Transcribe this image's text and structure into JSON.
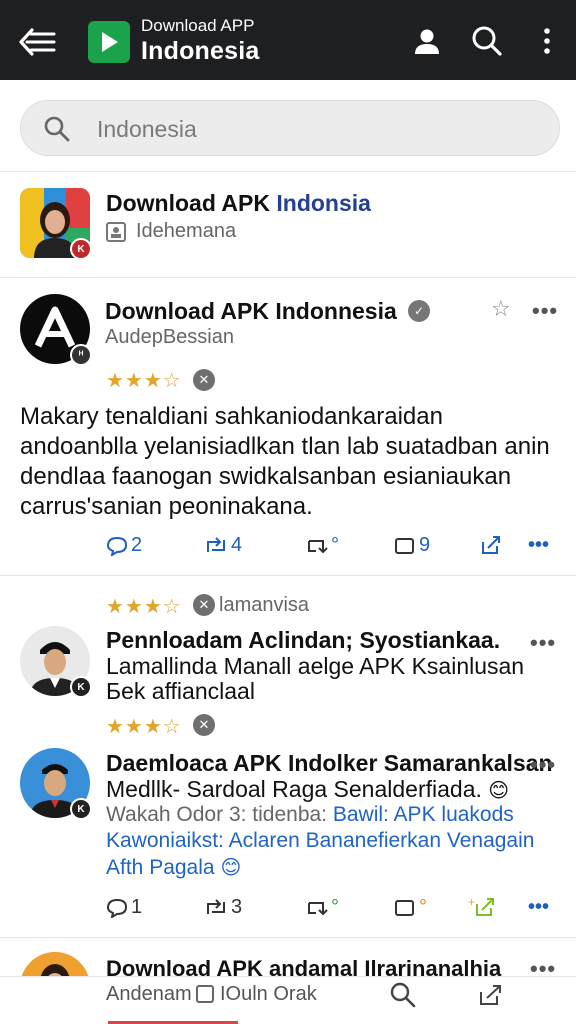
{
  "header": {
    "small_title": "Download APP",
    "big_title": "Indonesia",
    "back_icon": "back-arrow-icon",
    "logo_icon": "play-store-icon",
    "profile_icon": "profile-icon",
    "search_icon": "search-icon",
    "more_icon": "more-vertical-icon"
  },
  "search": {
    "value": "Indonesia"
  },
  "first_card": {
    "name_black": "Download APK ",
    "name_blue": "Indonsia",
    "sub": "Idehemana"
  },
  "post1": {
    "name": "Download APK Indonnesia",
    "handle": "AudepBessian",
    "stars": "★★★☆",
    "body": "Makary tenaldiani sahkaniodankaraidan andoanblla yelanisiadlkan tlan lab suatadban anin dendlaa faanogan swidkalsanban esianiaukan carrus'sanian peoninakana.",
    "actions": {
      "reply": "2",
      "repost": "4",
      "retweet": "°",
      "bookmark": "9",
      "share": "",
      "more": "•••"
    }
  },
  "post2": {
    "stars_top": "★★★☆",
    "top_label": "lamanvisa",
    "line1": "Pennloadam Aclindan; Syostiankaa.",
    "line2": "Lamallinda Manall aelge APK Ksainlusan",
    "line3": "Бek affianclaal",
    "stars_bottom": "★★★☆"
  },
  "post3": {
    "line1": "Daemloaca APK Indolker Samarankalsan",
    "line2": "Medllk- Sardoal Raga Senalderfiada.",
    "line3_gray": "Wakah Odor ",
    "line3_gray2": "3: tidenba: ",
    "line3_blue": "Bawil: APK luakods",
    "line4": "Kawoniaikst: Aclaren Bananefierkan Venagain",
    "line5": "Afth Pagala",
    "actions": {
      "reply": "1",
      "repost": "3",
      "retweet": "°",
      "bookmark": "°",
      "more": "•••"
    }
  },
  "bottom": {
    "name": "Download APK andamal Ilrarinanalhia",
    "sub1": "Andenam",
    "sub2": "IOuln Orak",
    "more": "•••"
  },
  "colors": {
    "accent": "#1f5fbf",
    "star": "#e3a52a",
    "topbar": "#1e1f21"
  }
}
